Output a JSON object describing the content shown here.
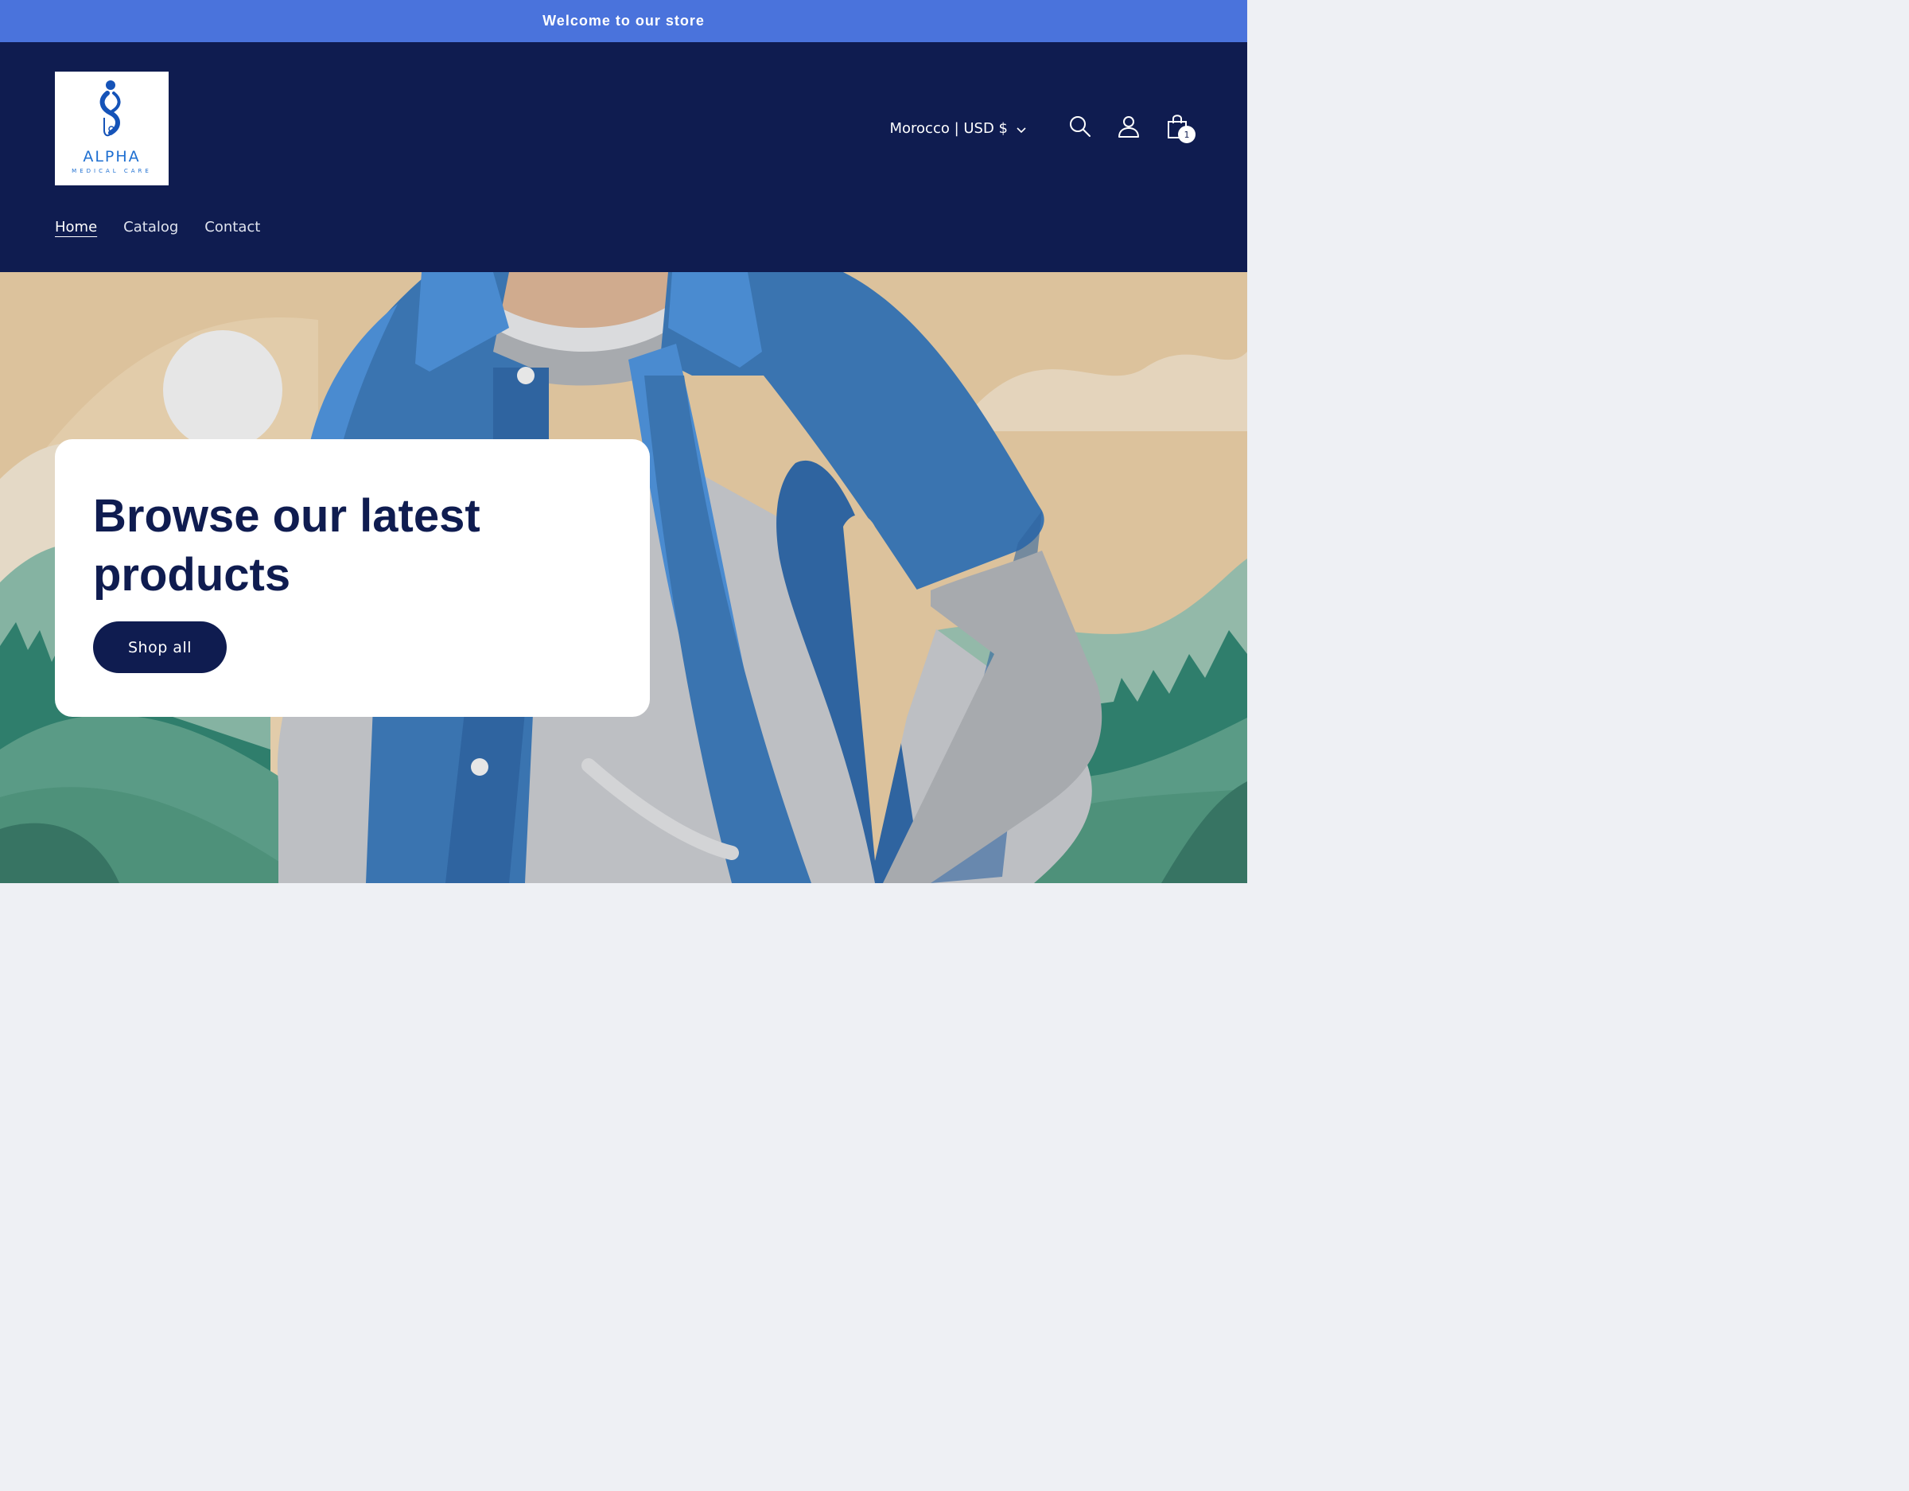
{
  "announcement": {
    "text": "Welcome to our store"
  },
  "logo": {
    "title": "ALPHA",
    "subtitle": "MEDICAL CARE"
  },
  "header": {
    "localization_label": "Morocco | USD $",
    "cart_count": "1",
    "icons": [
      "search-icon",
      "account-icon",
      "cart-icon",
      "chevron-down-icon"
    ]
  },
  "nav": {
    "items": [
      {
        "label": "Home",
        "active": true
      },
      {
        "label": "Catalog",
        "active": false
      },
      {
        "label": "Contact",
        "active": false
      }
    ]
  },
  "hero": {
    "heading": "Browse our latest products",
    "button_label": "Shop all"
  },
  "colors": {
    "announcement_bg": "#4a73dc",
    "header_bg": "#0f1c50",
    "accent": "#0f1c50",
    "page_bg": "#eef0f4"
  }
}
